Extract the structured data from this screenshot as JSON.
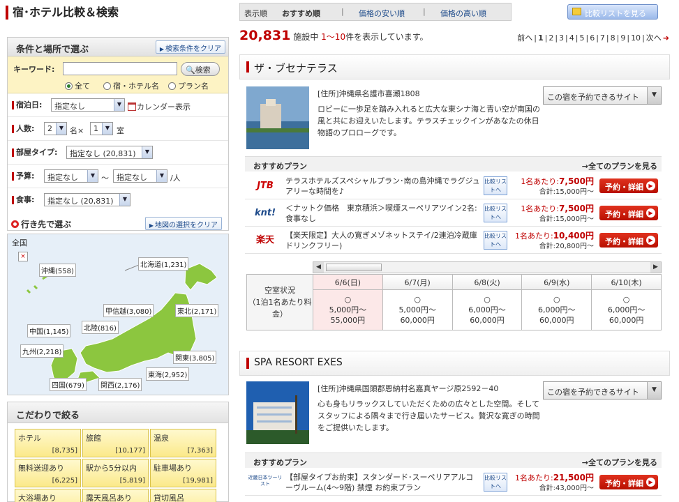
{
  "page_title": "宿･ホテル比較＆検索",
  "cond": {
    "title": "条件と場所で選ぶ",
    "clear": "検索条件をクリア",
    "keyword_label": "キーワード:",
    "search_btn": "検索",
    "radio": [
      "全て",
      "宿・ホテル名",
      "プラン名"
    ],
    "checkin_label": "宿泊日:",
    "checkin_value": "指定なし",
    "calendar": "カレンダー表示",
    "people_label": "人数:",
    "people_value": "2",
    "people_unit": "名×",
    "rooms_value": "1",
    "rooms_unit": "室",
    "room_type_label": "部屋タイプ:",
    "room_type_value": "指定なし (20,831)",
    "budget_label": "予算:",
    "budget_min": "指定なし",
    "budget_sep": "～",
    "budget_max": "指定なし",
    "budget_unit": "/人",
    "meal_label": "食事:",
    "meal_value": "指定なし (20,831)"
  },
  "dest": {
    "title": "行き先で選ぶ",
    "clear": "地図の選択をクリア",
    "all": "全国",
    "regions": {
      "okinawa": "沖縄(558)",
      "hokkaido": "北海道(1,231)",
      "koshinetsu": "甲信越(3,080)",
      "tohoku": "東北(2,171)",
      "chugoku": "中国(1,145)",
      "hokuriku": "北陸(816)",
      "kyushu": "九州(2,218)",
      "kanto": "関東(3,805)",
      "tokai": "東海(2,952)",
      "shikoku": "四国(679)",
      "kansai": "関西(2,176)"
    }
  },
  "kodawari": {
    "title": "こだわりで絞る",
    "items": [
      {
        "name": "ホテル",
        "count": "[8,735]"
      },
      {
        "name": "旅館",
        "count": "[10,177]"
      },
      {
        "name": "温泉",
        "count": "[7,363]"
      },
      {
        "name": "無料送迎あり",
        "count": "[6,225]"
      },
      {
        "name": "駅から5分以内",
        "count": "[5,819]"
      },
      {
        "name": "駐車場あり",
        "count": "[19,981]"
      },
      {
        "name": "大浴場あり",
        "count": ""
      },
      {
        "name": "露天風呂あり",
        "count": ""
      },
      {
        "name": "貸切風呂",
        "count": ""
      }
    ]
  },
  "sort": {
    "label": "表示順",
    "options": [
      "おすすめ順",
      "価格の安い順",
      "価格の高い順"
    ],
    "sep": "|"
  },
  "compare_btn": "比較リストを見る",
  "count": {
    "num": "20,831",
    "mid": "施設中",
    "range": "1〜10",
    "tail": "件を表示しています。"
  },
  "pager": {
    "prev": "前へ",
    "sep": "|",
    "pages": [
      "1",
      "2",
      "3",
      "4",
      "5",
      "6",
      "7",
      "8",
      "9",
      "10"
    ],
    "next": "次へ"
  },
  "hotels": [
    {
      "name": "ザ・ブセナテラス",
      "address": "[住所]沖縄県名護市喜瀬1808",
      "desc": "ロビーに一歩足を踏み入れると広大な東シナ海と青い空が南国の風と共にお迎えいたします。テラスチェックインがあなたの休日物語のプロローグです。",
      "site_sel": "この宿を予約できるサイト",
      "plan_label": "おすすめプラン",
      "plan_all": "→全てのプランを見る",
      "plans": [
        {
          "logo": "JTB",
          "name": "テラスホテルズスペシャルプラン･南の島沖縄でラグジュアリーな時間を♪",
          "cmp": "比較リストへ",
          "per_label": "1名あたり:",
          "per": "7,500円",
          "total": "合計:15,000円～",
          "rsv": "予約・詳細"
        },
        {
          "logo": "knt!",
          "name": "＜ナットク価格　東京積浜＞喫煙スーペリアツイン2名:食事なし",
          "cmp": "比較リストへ",
          "per_label": "1名あたり:",
          "per": "7,500円",
          "total": "合計:15,000円～",
          "rsv": "予約・詳細"
        },
        {
          "logo": "楽天",
          "name": "【楽天限定】大人の寛ぎメゾネットステイ/2連泊冷蔵庫ドリンクフリー)",
          "cmp": "比較リストへ",
          "per_label": "1名あたり:",
          "per": "10,400円",
          "total": "合計:20,800円～",
          "rsv": "予約・詳細"
        }
      ],
      "cal": {
        "side": "空室状況\n（1泊1名あたり料金）",
        "days": [
          "6/6(日)",
          "6/7(月)",
          "6/8(火)",
          "6/9(水)",
          "6/10(木)"
        ],
        "cells": [
          {
            "mark": "○",
            "min": "5,000円～",
            "max": "55,000円"
          },
          {
            "mark": "○",
            "min": "5,000円～",
            "max": "60,000円"
          },
          {
            "mark": "○",
            "min": "6,000円～",
            "max": "60,000円"
          },
          {
            "mark": "○",
            "min": "6,000円～",
            "max": "60,000円"
          },
          {
            "mark": "○",
            "min": "6,000円～",
            "max": "60,000円"
          }
        ]
      }
    },
    {
      "name": "SPA RESORT EXES",
      "address": "[住所]沖縄県国頭郡恩納村名嘉真ヤージ原2592－40",
      "desc": "心も身もリラックスしていただくための広々とした空間。そしてスタッフによる隅々まで行き届いたサービス。贅沢な寛ぎの時間をご提供いたします。",
      "site_sel": "この宿を予約できるサイト",
      "plan_label": "おすすめプラン",
      "plan_all": "→全てのプランを見る",
      "plans": [
        {
          "logo": "近畿日本ツーリスト",
          "name": "【部屋タイプお約束】スタンダード･スーペリアアルコーヴルーム(4〜9階) 禁煙 お約束プラン",
          "cmp": "比較リストへ",
          "per_label": "1名あたり:",
          "per": "21,500円",
          "total": "合計:43,000円～",
          "rsv": "予約・詳細"
        }
      ]
    }
  ],
  "colors": {
    "accent": "#bf0000",
    "map_land": "#8cc63f",
    "sea": "#e6eff8"
  }
}
